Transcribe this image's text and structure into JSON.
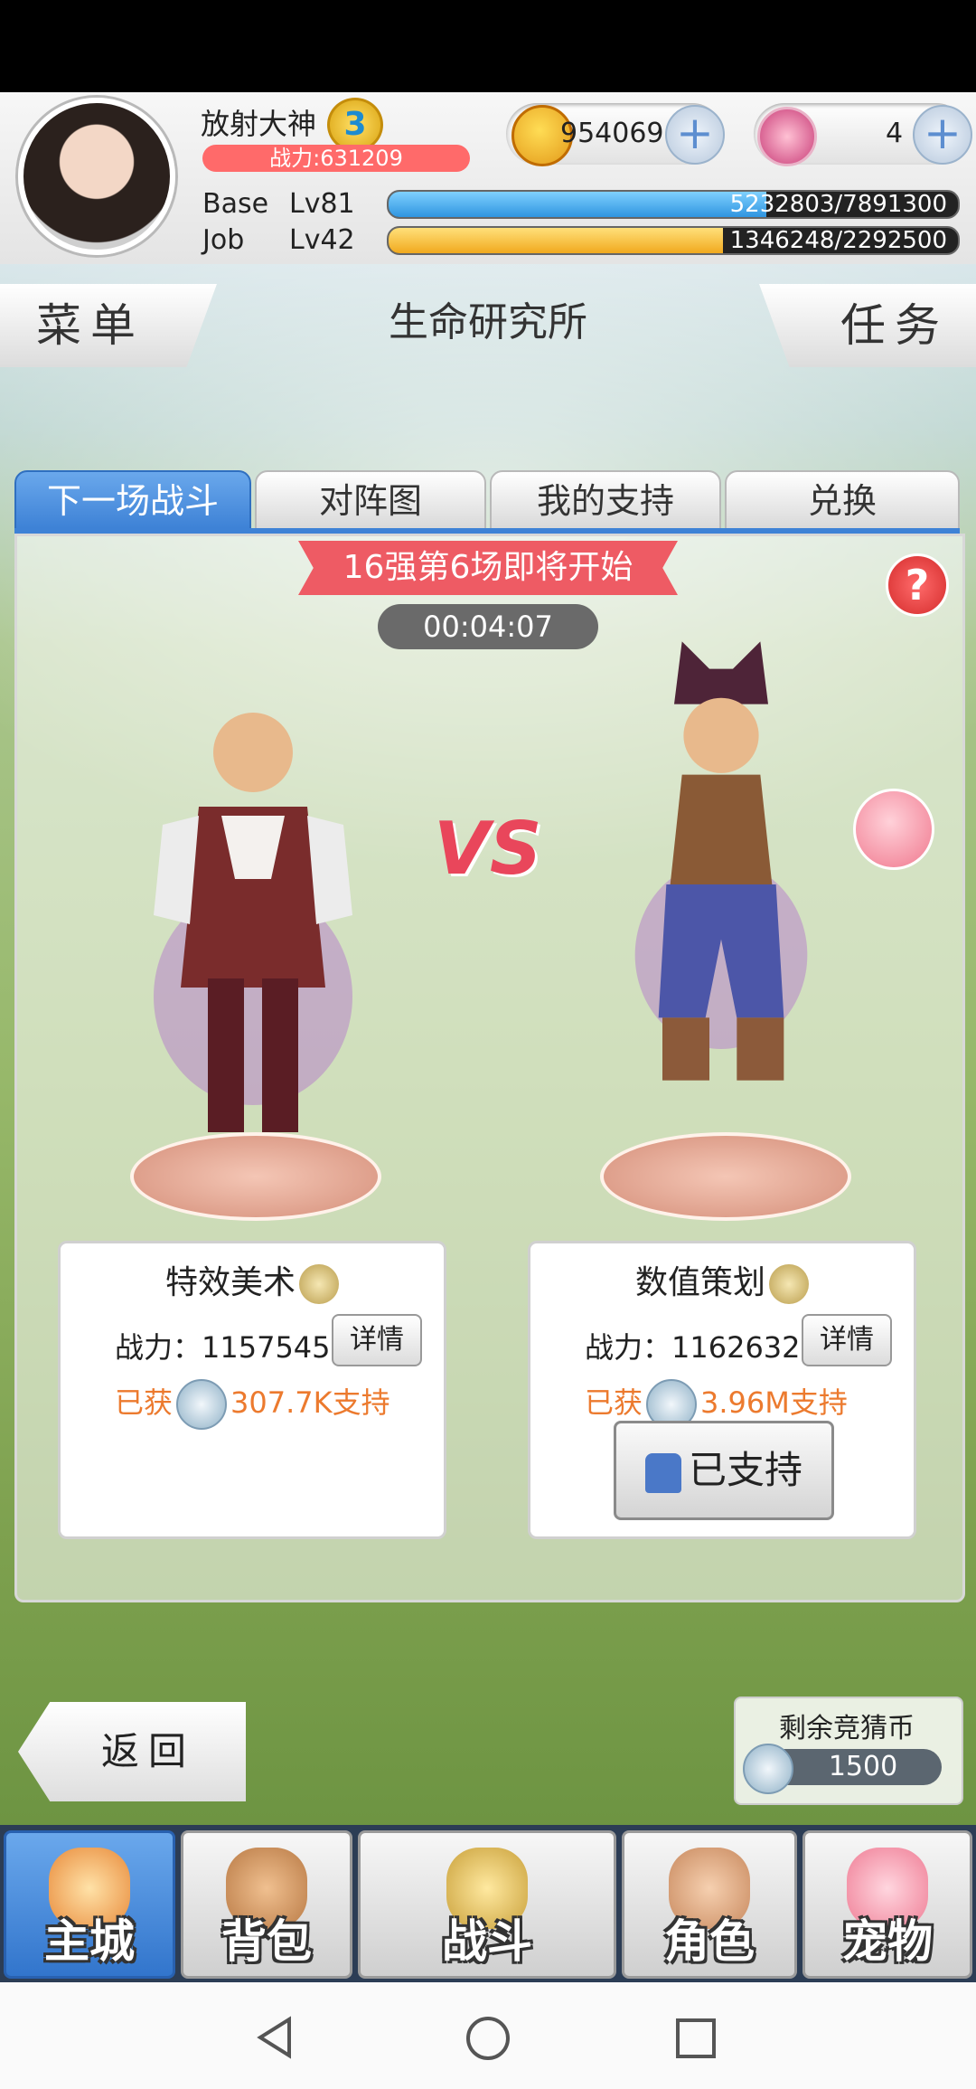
{
  "player": {
    "name": "放射大神",
    "rank_badge": "3",
    "power_text": "战力:631209"
  },
  "currency": {
    "coins": "954069",
    "gems": "4",
    "plus_glyph": "+"
  },
  "levels": {
    "base_label": "Base",
    "base_level": "Lv81",
    "base_exp": "5232803/7891300",
    "base_progress": 0.663,
    "job_label": "Job",
    "job_level": "Lv42",
    "job_exp": "1346248/2292500",
    "job_progress": 0.587
  },
  "top_bar": {
    "menu": "菜单",
    "title": "生命研究所",
    "tasks": "任务"
  },
  "tabs": [
    {
      "label": "下一场战斗",
      "active": true
    },
    {
      "label": "对阵图",
      "active": false
    },
    {
      "label": "我的支持",
      "active": false
    },
    {
      "label": "兑换",
      "active": false
    }
  ],
  "match": {
    "banner": "16强第6场即将开始",
    "countdown": "00:04:07",
    "vs": "VS",
    "help": "?"
  },
  "left_fighter": {
    "name": "特效美术",
    "power": "战力：1157545",
    "detail": "详情",
    "support_prefix": "已获",
    "support_amount": "307.7K支持"
  },
  "right_fighter": {
    "name": "数值策划",
    "power": "战力：1162632",
    "detail": "详情",
    "support_prefix": "已获",
    "support_amount": "3.96M支持",
    "supported_button": "已支持"
  },
  "footer_game": {
    "back": "返回",
    "coins_left_label": "剩余竞猜币",
    "coins_left_value": "1500"
  },
  "bottom_nav": [
    {
      "label": "主城",
      "icon": "castle-icon",
      "active": true
    },
    {
      "label": "背包",
      "icon": "backpack-icon",
      "active": false
    },
    {
      "label": "战斗",
      "icon": "battle-icon",
      "active": false
    },
    {
      "label": "角色",
      "icon": "character-icon",
      "active": false
    },
    {
      "label": "宠物",
      "icon": "pet-icon",
      "active": false
    }
  ],
  "colors": {
    "accent_blue": "#3e82d6",
    "banner_red": "#ee5b64",
    "support_orange": "#ec7a2e",
    "base_bar": "#3aa9ee",
    "job_bar": "#f6c23e"
  }
}
